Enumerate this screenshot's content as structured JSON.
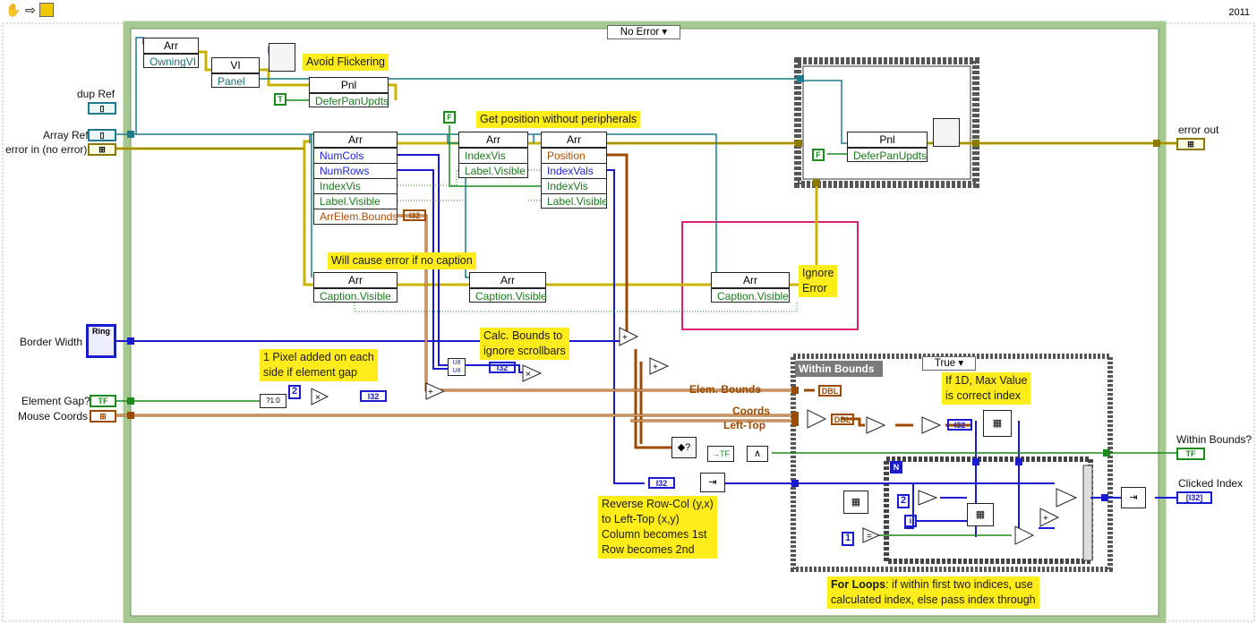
{
  "toolbar": {
    "year": "2011"
  },
  "case_structure": {
    "selector_label": "No Error"
  },
  "inner_case": {
    "selector_label": "True",
    "frame_title": "Within Bounds"
  },
  "controls": {
    "dup_ref": "dup Ref",
    "array_ref": "Array Ref",
    "error_in": "error in (no error)",
    "border_width": "Border Width",
    "element_gap": "Element Gap?",
    "mouse_coords": "Mouse Coords"
  },
  "indicators": {
    "error_out": "error out",
    "within_bounds": "Within Bounds?",
    "clicked_index": "Clicked Index"
  },
  "notes": {
    "avoid_flickering": "Avoid Flickering",
    "get_position": "Get position without peripherals",
    "will_cause_error": "Will cause error if no caption",
    "calc_bounds": [
      "Calc. Bounds to",
      "ignore scrollbars"
    ],
    "pixel_added": [
      "1 Pixel added on each",
      "side if element gap"
    ],
    "ignore_error": [
      "Ignore",
      "Error"
    ],
    "if_1d": [
      "If 1D, Max Value",
      "is correct index"
    ],
    "reverse": [
      "Reverse Row-Col (y,x)",
      "to Left-Top (x,y)",
      "Column becomes 1st",
      "Row becomes 2nd"
    ],
    "for_loops_bold": "For Loops",
    "for_loops_rest": ": if within first two indices, use",
    "for_loops_line2": "calculated index, else pass index through"
  },
  "nodes": {
    "arr_owning": {
      "head": "Arr",
      "props": [
        "OwningVI"
      ]
    },
    "vi_panel": {
      "head": "VI",
      "props": [
        "Panel"
      ]
    },
    "pnl_defer": {
      "head": "Pnl",
      "props": [
        "DeferPanUpdts"
      ]
    },
    "arr_main": {
      "head": "Arr",
      "props": [
        "NumCols",
        "NumRows",
        "IndexVis",
        "Label.Visible",
        "ArrElem.Bounds"
      ]
    },
    "arr_vis": {
      "head": "Arr",
      "props": [
        "IndexVis",
        "Label.Visible"
      ]
    },
    "arr_pos": {
      "head": "Arr",
      "props": [
        "Position",
        "IndexVals",
        "IndexVis",
        "Label.Visible"
      ]
    },
    "arr_cap1": {
      "head": "Arr",
      "props": [
        "Caption.Visible"
      ]
    },
    "arr_cap2": {
      "head": "Arr",
      "props": [
        "Caption.Visible"
      ]
    },
    "arr_cap3": {
      "head": "Arr",
      "props": [
        "Caption.Visible"
      ]
    },
    "pnl_defer2": {
      "head": "Pnl",
      "props": [
        "DeferPanUpdts"
      ]
    }
  },
  "wire_labels": {
    "elem_bounds": "Elem. Bounds",
    "coords": "Coords",
    "left_top": "Left-Top"
  },
  "terminals": {
    "i32": "I32",
    "dbl": "DBL",
    "n": "N",
    "i": "i",
    "const_1": "1",
    "const_2": "2",
    "const_2b": "2",
    "bool_t": "T",
    "bool_f": "F",
    "bool_f2": "F"
  },
  "colors": {
    "error_wire": "#c8b400",
    "ref_wire": "#1f7a8c",
    "int_wire": "#1a1ad0",
    "cluster_wire": "#9b4a00",
    "bool_wire": "#1c8a1c",
    "case_border": "#9ac48a",
    "highlight": "#e0206c",
    "note_bg": "#ffec1a"
  }
}
